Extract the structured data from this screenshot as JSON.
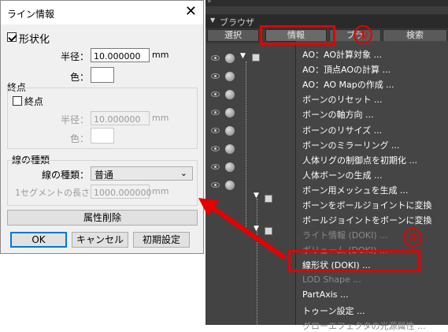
{
  "dialog": {
    "title": "ライン情報",
    "close_glyph": "✕",
    "shape_label": "形状化",
    "radius_label": "半径：",
    "radius_value": "10.000000",
    "radius_unit": "mm",
    "color_label": "色：",
    "endpoint": {
      "heading": "終点",
      "checkbox_label": "終点",
      "radius_label": "半径：",
      "radius_value": "10.000000",
      "radius_unit": "mm",
      "color_label": "色："
    },
    "line_type": {
      "heading": "線の種類",
      "type_label": "線の種類：",
      "type_value": "普通",
      "segment_label": "1セグメントの長さ：",
      "segment_value": "1000.000000",
      "segment_unit": "mm"
    },
    "delete_attr_label": "属性削除",
    "ok_label": "OK",
    "cancel_label": "キャンセル",
    "reset_label": "初期設定"
  },
  "panel": {
    "topbar_glyph": "»",
    "title": "ブラウザ",
    "tabs": [
      "選択",
      "情報",
      "ブラ",
      "検索"
    ]
  },
  "menu": {
    "items": [
      {
        "label": "AO：AO計算対象 ...",
        "enabled": true
      },
      {
        "label": "AO：頂点AOの計算 ...",
        "enabled": true
      },
      {
        "label": "AO：AO Mapの作成 ...",
        "enabled": true
      },
      {
        "label": "ボーンのリセット ...",
        "enabled": true
      },
      {
        "label": "ボーンの軸方向 ...",
        "enabled": true
      },
      {
        "label": "ボーンのリサイズ ...",
        "enabled": true
      },
      {
        "label": "ボーンのミラーリング ...",
        "enabled": true
      },
      {
        "label": "人体リグの制御点を初期化 ...",
        "enabled": true
      },
      {
        "label": "人体ボーンの生成 ...",
        "enabled": true
      },
      {
        "label": "ボーン用メッシュを生成 ...",
        "enabled": true
      },
      {
        "label": "ボーンをボールジョイントに変換",
        "enabled": true
      },
      {
        "label": "ボールジョイントをボーンに変換",
        "enabled": true
      },
      {
        "label": "ライト情報 (DOKI) ...",
        "enabled": false
      },
      {
        "label": "ボリューム (DOKI) ...",
        "enabled": false
      },
      {
        "label": "線形状 (DOKI) ...",
        "enabled": true
      },
      {
        "label": "LOD Shape ...",
        "enabled": false
      },
      {
        "label": "PartAxis ...",
        "enabled": true
      },
      {
        "label": "トゥーン設定 ...",
        "enabled": true
      },
      {
        "label": "グローエフェクタの光源属性 ...",
        "enabled": false
      }
    ]
  },
  "annotations": {
    "badge1": "①",
    "badge2": "②"
  },
  "colors": {
    "accent_red": "#e60000",
    "menu_bg": "#454545",
    "panel_bg": "#3c3c3c"
  }
}
